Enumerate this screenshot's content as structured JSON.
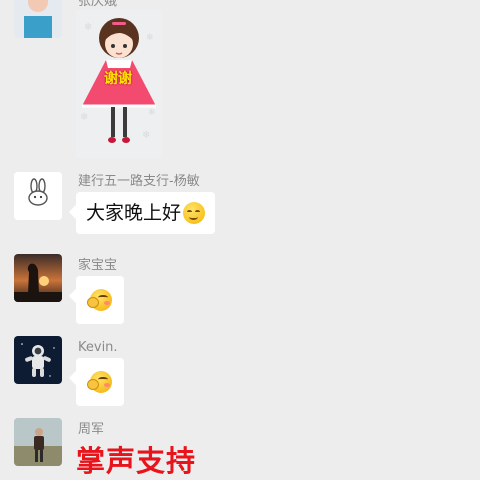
{
  "messages": [
    {
      "sender": "张庆娥",
      "type": "sticker",
      "sticker_text": "谢谢"
    },
    {
      "sender": "建行五一路支行-杨敏",
      "type": "text",
      "text": "大家晚上好",
      "emoji": "smile-emoji"
    },
    {
      "sender": "家宝宝",
      "type": "sticker",
      "emoji": "blushing-emoji"
    },
    {
      "sender": "Kevin.",
      "type": "sticker",
      "emoji": "blushing-emoji"
    },
    {
      "sender": "周军",
      "type": "sticker",
      "sticker_text": "掌声支持"
    }
  ],
  "colors": {
    "background": "#ededed",
    "bubble": "#ffffff",
    "nickname": "#8a8a8a",
    "applause_red": "#e8131b"
  }
}
